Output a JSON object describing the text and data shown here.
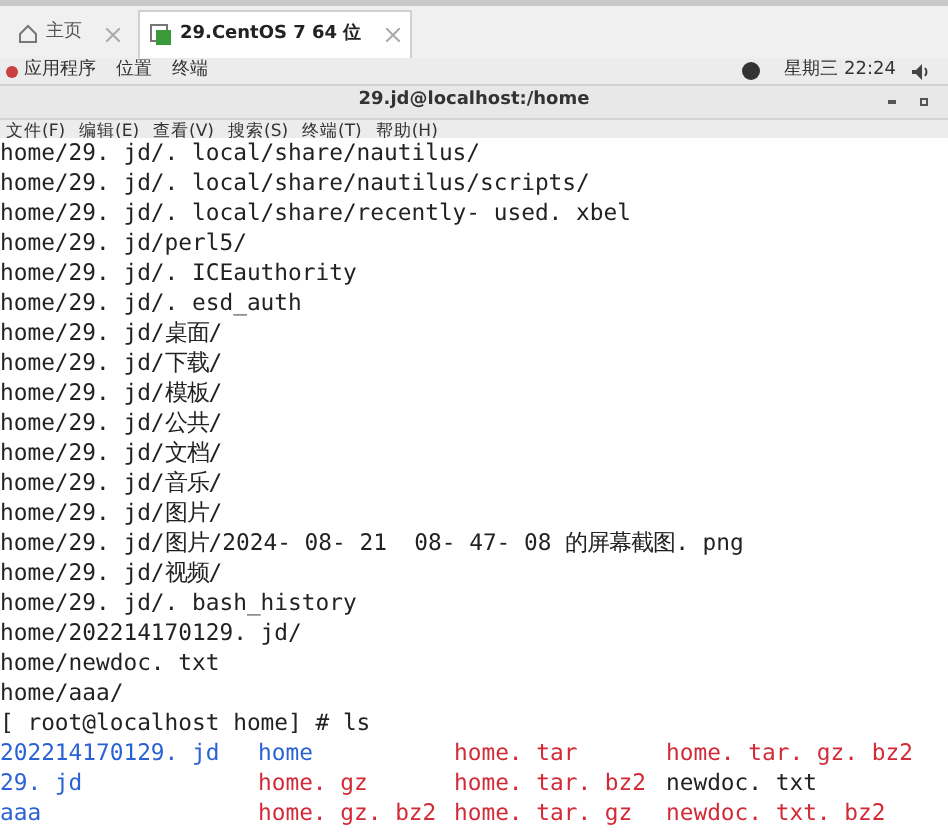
{
  "browser_tabs": [
    {
      "label": "主页",
      "selected": false
    },
    {
      "label": "29.CentOS 7 64 位",
      "selected": true
    }
  ],
  "top_bar": {
    "menus": [
      "应用程序",
      "位置",
      "终端"
    ],
    "clock": "星期三 22:24"
  },
  "window": {
    "title": "29.jd@localhost:/home"
  },
  "menu_bar": [
    "文件(F)",
    "编辑(E)",
    "查看(V)",
    "搜索(S)",
    "终端(T)",
    "帮助(H)"
  ],
  "terminal": {
    "lines": [
      "home/29. jd/. local/share/nautilus/",
      "home/29. jd/. local/share/nautilus/scripts/",
      "home/29. jd/. local/share/recently- used. xbel",
      "home/29. jd/perl5/",
      "home/29. jd/. ICEauthority",
      "home/29. jd/. esd_auth",
      "home/29. jd/桌面/",
      "home/29. jd/下载/",
      "home/29. jd/模板/",
      "home/29. jd/公共/",
      "home/29. jd/文档/",
      "home/29. jd/音乐/",
      "home/29. jd/图片/",
      "home/29. jd/图片/2024- 08- 21  08- 47- 08 的屏幕截图. png",
      "home/29. jd/视频/",
      "home/29. jd/. bash_history",
      "home/202214170129. jd/",
      "home/newdoc. txt",
      "home/aaa/",
      "[ root@localhost home] # ls"
    ],
    "ls_rows": [
      [
        {
          "name": "202214170129. jd",
          "kind": "dir"
        },
        {
          "name": "home",
          "kind": "dir"
        },
        {
          "name": "home. tar",
          "kind": "archive"
        },
        {
          "name": "home. tar. gz. bz2",
          "kind": "archive"
        }
      ],
      [
        {
          "name": "29. jd",
          "kind": "dir"
        },
        {
          "name": "home. gz",
          "kind": "archive"
        },
        {
          "name": "home. tar. bz2",
          "kind": "archive"
        },
        {
          "name": "newdoc. txt",
          "kind": "file"
        }
      ],
      [
        {
          "name": "aaa",
          "kind": "dir"
        },
        {
          "name": "home. gz. bz2",
          "kind": "archive"
        },
        {
          "name": "home. tar. gz",
          "kind": "archive"
        },
        {
          "name": "newdoc. txt. bz2",
          "kind": "archive"
        }
      ]
    ]
  }
}
